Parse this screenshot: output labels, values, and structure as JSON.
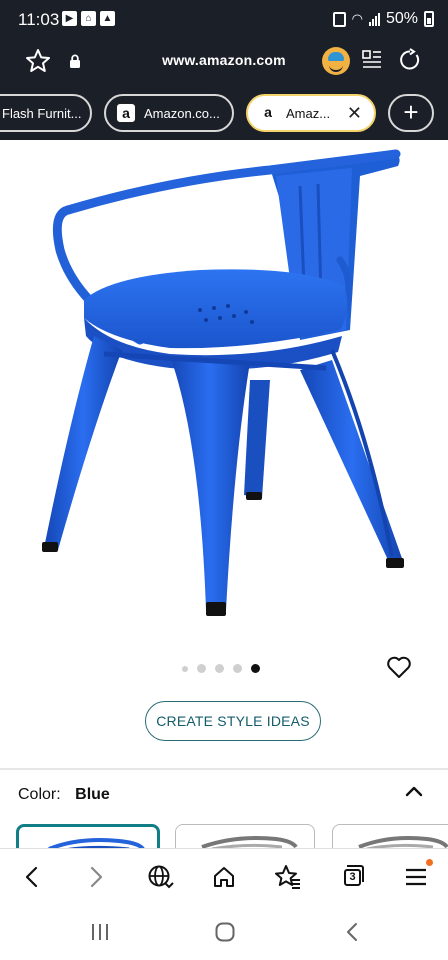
{
  "status": {
    "time": "11:03",
    "battery": "50%"
  },
  "url_bar": {
    "url": "www.amazon.com"
  },
  "tabs": [
    {
      "label": "Flash Furnit..."
    },
    {
      "label": "Amazon.co..."
    },
    {
      "label": "Amaz...",
      "active": true
    }
  ],
  "product": {
    "image_dots_total": 5,
    "image_dots_active": 5,
    "create_style_label": "CREATE STYLE IDEAS",
    "color_label": "Color:",
    "color_value": "Blue"
  },
  "browser_bottom": {
    "tab_count": "3"
  },
  "colors": {
    "chair_blue": "#1f5fd6",
    "teal_accent": "#127e88",
    "dark_bar": "#1b1f27",
    "notification_dot": "#f26f21"
  }
}
